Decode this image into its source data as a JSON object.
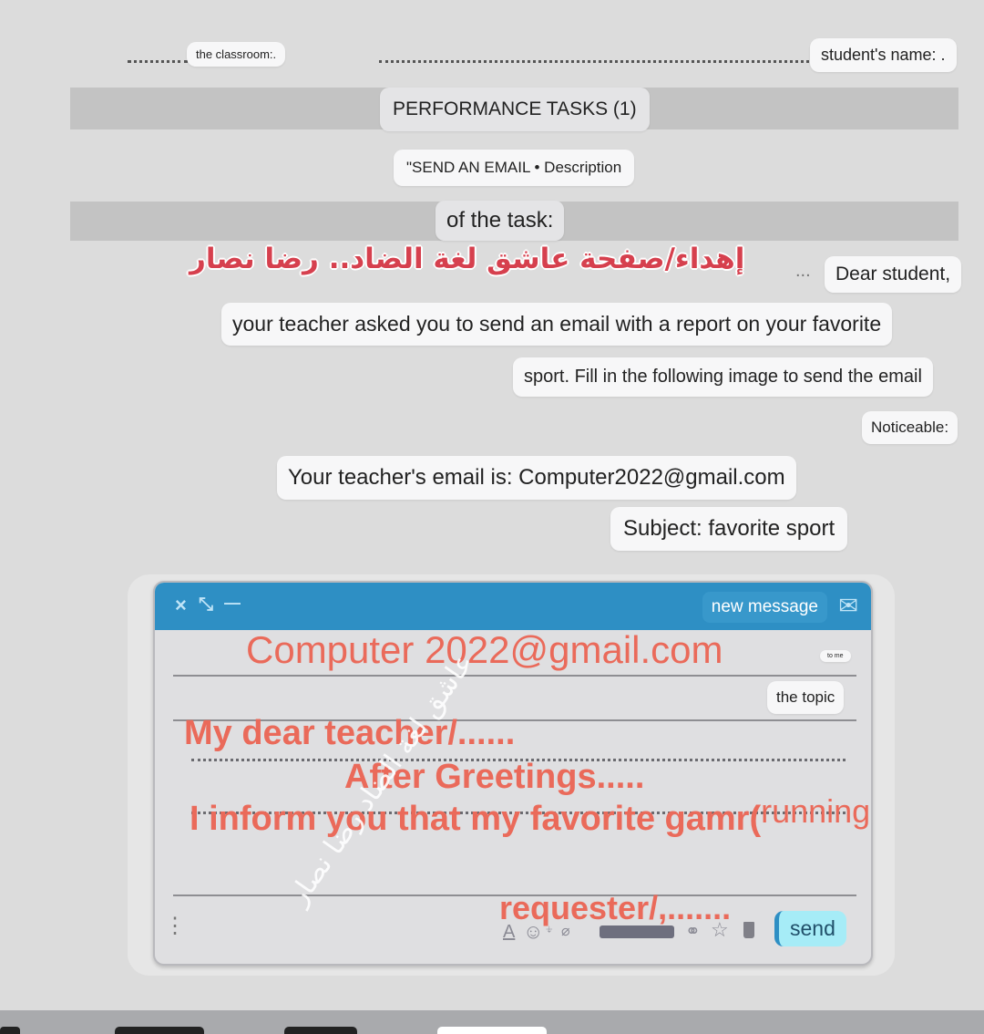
{
  "worksheet": {
    "classroom_label": "the classroom:.",
    "student_name_label": "student's name: .",
    "title": "PERFORMANCE TASKS (1)",
    "task_name": "\"SEND AN EMAIL • Description",
    "task_name_cont": "of the task:",
    "dedication_arabic": "إهداء/صفحة عاشق لغة الضاد.. رضا نصار",
    "ellipsis": "...",
    "greeting": "Dear student,",
    "instruction_line1": "your teacher asked you to send an email with a report on your favorite",
    "instruction_line2": "sport. Fill in the following image to send the email",
    "note_label": "Noticeable:",
    "teacher_email_line": "Your teacher's email is: Computer2022@gmail.com",
    "subject_line": "Subject: favorite sport"
  },
  "compose": {
    "header": {
      "close_icon": "×",
      "expand_icon": "⤡",
      "minimize_icon": "—",
      "title": "new message",
      "mail_icon": "✉"
    },
    "to_label": "to me",
    "topic_label": "the topic",
    "handwritten": {
      "to_value": "Computer 2022@gmail.com",
      "salutation": "My dear teacher/......",
      "greeting": "After Greetings.....",
      "body": "I inform you that my favorite gamr(",
      "body_answer": "running",
      "body_close": " )",
      "signature": "requester/,......."
    },
    "watermark_arabic": "عاشق لغة الضاد رضا نصار",
    "toolbar": {
      "more_icon": "⋮",
      "format_icon": "A",
      "emoji_icon": "☺",
      "drive_icon": "⍖",
      "attach_icon": "⌀",
      "link_icon": "⚭",
      "star_icon": "☆",
      "trash_icon": "🗑",
      "send_label": "send"
    }
  },
  "colors": {
    "header_blue": "#2e8fc4",
    "handwritten_red": "#ea6a5a",
    "arabic_title_red": "#d6404e",
    "send_button": "#a6ecf7"
  }
}
